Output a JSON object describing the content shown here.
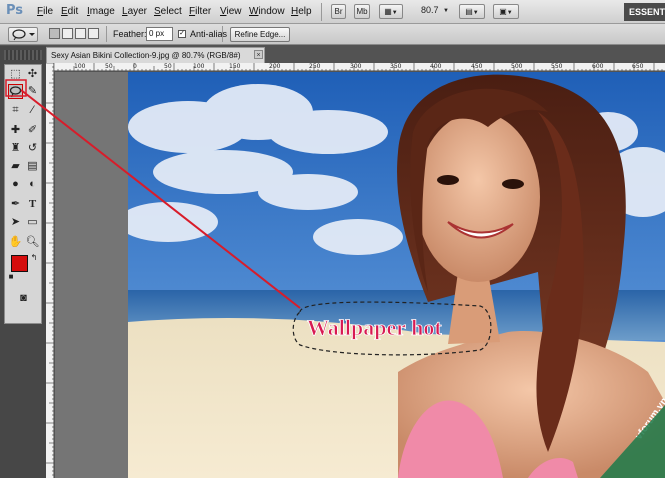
{
  "app": {
    "logo": "Ps"
  },
  "menu": [
    {
      "label": "File",
      "accel": "F",
      "rest": "ile"
    },
    {
      "label": "Edit",
      "accel": "E",
      "rest": "dit"
    },
    {
      "label": "Image",
      "accel": "I",
      "rest": "mage"
    },
    {
      "label": "Layer",
      "accel": "L",
      "rest": "ayer"
    },
    {
      "label": "Select",
      "accel": "S",
      "rest": "elect"
    },
    {
      "label": "Filter",
      "accel": "F",
      "rest": "ilter"
    },
    {
      "label": "View",
      "accel": "V",
      "rest": "iew"
    },
    {
      "label": "Window",
      "accel": "W",
      "rest": "indow"
    },
    {
      "label": "Help",
      "accel": "H",
      "rest": "elp"
    }
  ],
  "menubar_buttons": {
    "bridge": "Br",
    "mini_bridge": "Mb",
    "zoom": "80.7"
  },
  "workspace": "ESSENT",
  "options": {
    "feather_label": "Feather:",
    "feather_value": "0 px",
    "antialias_label": "Anti-alias",
    "antialias_checked": true,
    "refine_edge_label": "Refine Edge..."
  },
  "document": {
    "tab_title": "Sexy Asian Bikini Collection-9.jpg @ 80.7% (RGB/8#)",
    "close_glyph": "×"
  },
  "ruler_ticks": [
    "100",
    "50",
    "0",
    "50",
    "100",
    "150",
    "200",
    "250",
    "300",
    "350",
    "400",
    "450",
    "500",
    "550",
    "600",
    "650"
  ],
  "image": {
    "overlay_text": "Wallpaper hot",
    "watermark": "vforum.vn"
  },
  "colors": {
    "foreground": "#d50d0d",
    "background": "#f5b800",
    "annotation_line": "#d81c2a",
    "overlay_text": "#d81a52"
  },
  "tools": [
    "rect-marquee-icon",
    "move-icon",
    "lasso-icon",
    "quick-select-icon",
    "crop-icon",
    "eyedropper-icon",
    "healing-brush-icon",
    "brush-icon",
    "clone-stamp-icon",
    "history-brush-icon",
    "eraser-icon",
    "gradient-icon",
    "blur-icon",
    "dodge-icon",
    "pen-icon",
    "type-icon",
    "path-select-icon",
    "shape-icon",
    "hand-icon",
    "zoom-icon"
  ]
}
